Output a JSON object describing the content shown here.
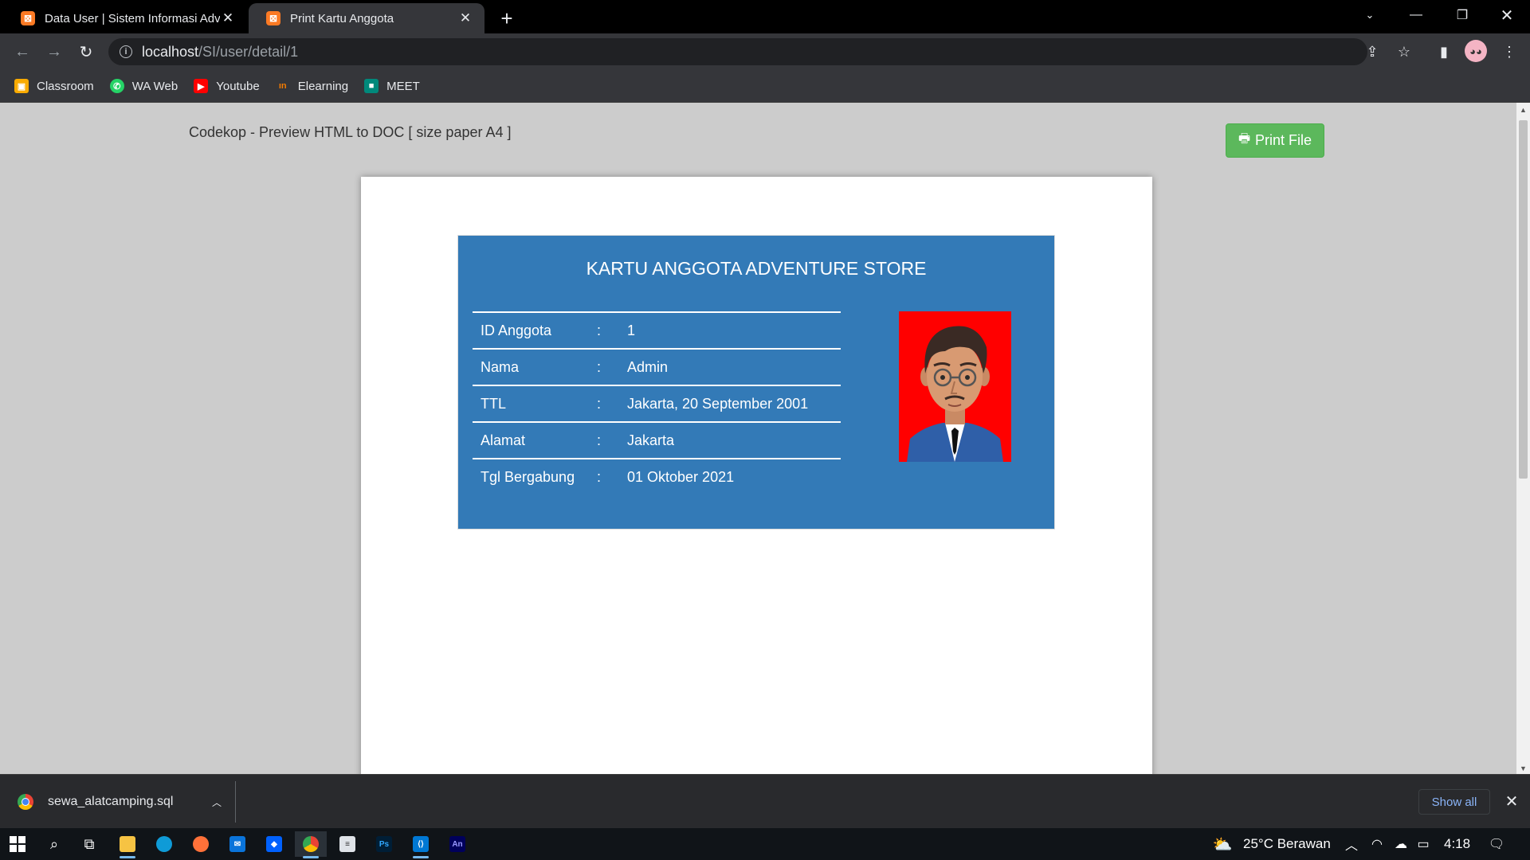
{
  "tabs": [
    {
      "title": "Data User | Sistem Informasi Adventure Store",
      "favicon": "xampp-icon"
    },
    {
      "title": "Print Kartu Anggota",
      "favicon": "xampp-icon"
    }
  ],
  "address_bar": {
    "host": "localhost",
    "path": "/SI/user/detail/1"
  },
  "bookmarks": [
    {
      "label": "Classroom",
      "icon": "classroom-icon",
      "color": "#f9ab00"
    },
    {
      "label": "WA Web",
      "icon": "whatsapp-icon",
      "color": "#25d366"
    },
    {
      "label": "Youtube",
      "icon": "youtube-icon",
      "color": "#ff0000"
    },
    {
      "label": "Elearning",
      "icon": "elearning-icon",
      "color": "#f57c00"
    },
    {
      "label": "MEET",
      "icon": "meet-icon",
      "color": "#00897b"
    }
  ],
  "page": {
    "preview_title": "Codekop - Preview HTML to DOC [ size paper A4 ]",
    "print_button": "Print File",
    "print_button_color": "#5cb85c"
  },
  "card": {
    "title": "KARTU ANGGOTA ADVENTURE STORE",
    "background": "#337ab7",
    "rows": [
      {
        "label": "ID Anggota",
        "sep": ":",
        "value": "1"
      },
      {
        "label": "Nama",
        "sep": ":",
        "value": "Admin"
      },
      {
        "label": "TTL",
        "sep": ":",
        "value": "Jakarta, 20 September 2001"
      },
      {
        "label": "Alamat",
        "sep": ":",
        "value": "Jakarta"
      },
      {
        "label": "Tgl Bergabung",
        "sep": ":",
        "value": "01 Oktober 2021"
      }
    ],
    "photo_background": "#ff0000"
  },
  "downloads": {
    "file_name": "sewa_alatcamping.sql",
    "show_all": "Show all"
  },
  "taskbar": {
    "weather": "25°C  Berawan",
    "time": "4:18"
  }
}
